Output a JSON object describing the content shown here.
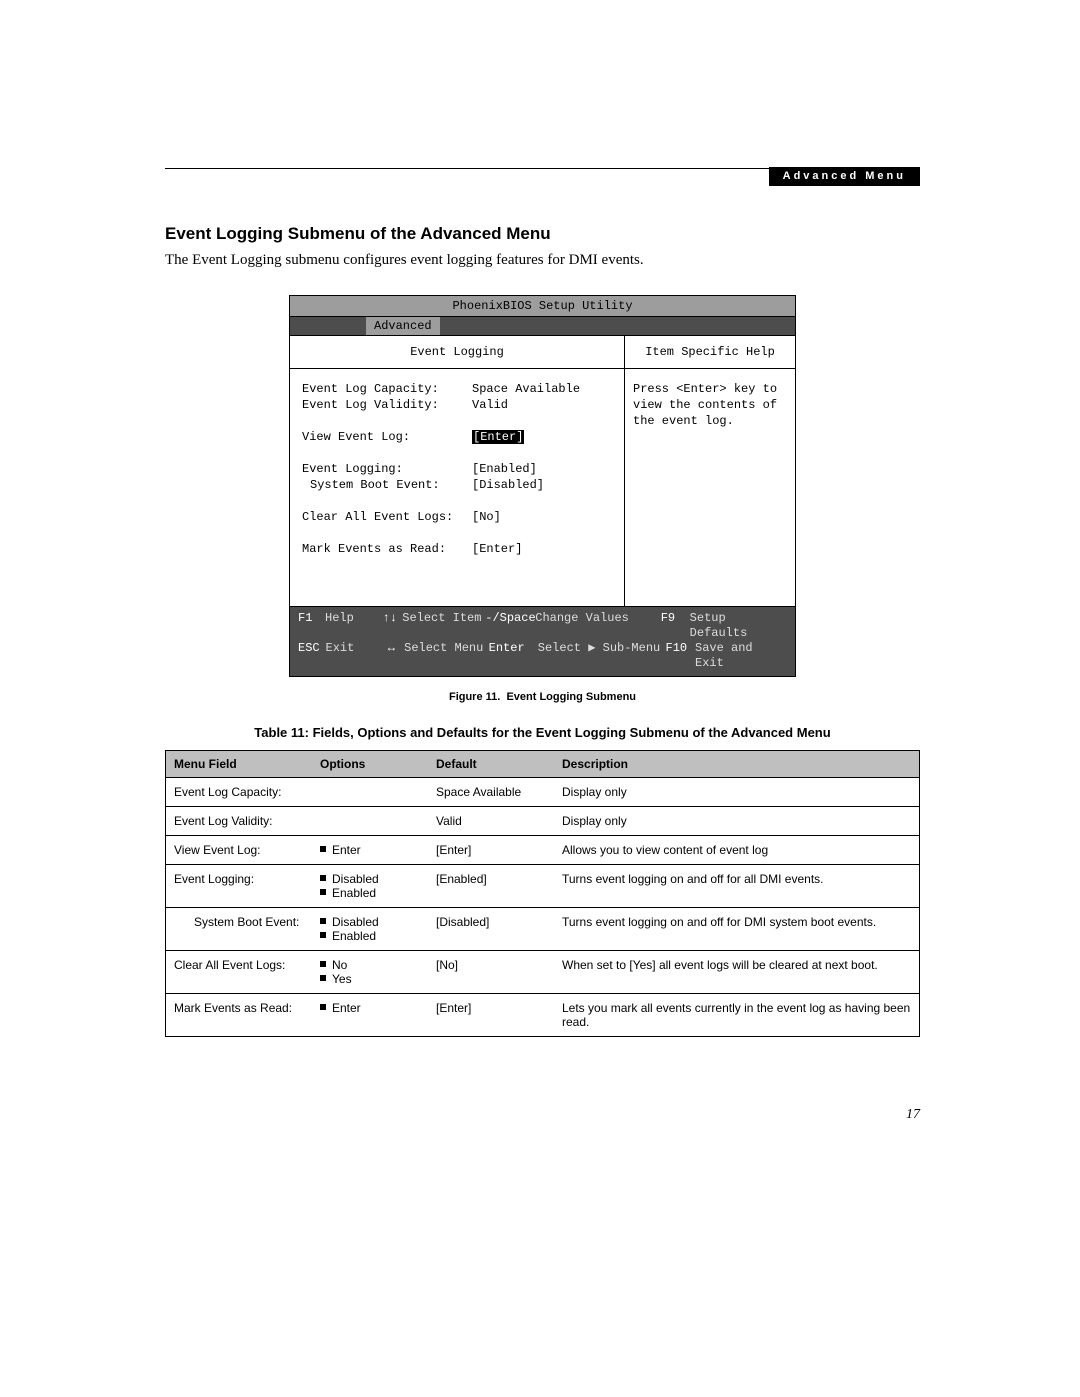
{
  "header_tab": "Advanced Menu",
  "heading": "Event Logging Submenu of the Advanced Menu",
  "intro": "The Event Logging submenu configures event logging features for DMI events.",
  "bios": {
    "title": "PhoenixBIOS Setup Utility",
    "menu_tab": "Advanced",
    "left_header": "Event Logging",
    "right_header": "Item Specific Help",
    "help_text": "Press <Enter> key to view the contents of the event log.",
    "fields": {
      "cap_label": "Event Log Capacity:",
      "cap_val": "Space Available",
      "val_label": "Event Log Validity:",
      "val_val": "Valid",
      "view_label": "View Event Log:",
      "view_val": "[Enter]",
      "log_label": "Event Logging:",
      "log_val": "[Enabled]",
      "boot_label": "System Boot Event:",
      "boot_val": "[Disabled]",
      "clear_label": "Clear All Event Logs:",
      "clear_val": "[No]",
      "mark_label": "Mark Events as Read:",
      "mark_val": "[Enter]"
    },
    "footer": {
      "f1": "F1",
      "help": "Help",
      "arr_ud": "↑↓",
      "sel_item": "Select Item",
      "pm": "-/Space",
      "chg": "Change Values",
      "f9": "F9",
      "setdef": "Setup Defaults",
      "esc": "ESC",
      "exit": "Exit",
      "arr_lr": "↔",
      "sel_menu": "Select Menu",
      "enter": "Enter",
      "sub": "Select ▶ Sub-Menu",
      "f10": "F10",
      "save": "Save and Exit"
    }
  },
  "figcaption_label": "Figure 11.",
  "figcaption_text": "Event Logging Submenu",
  "table_caption": "Table 11: Fields, Options and Defaults for the Event Logging Submenu of the Advanced Menu",
  "table": {
    "headers": {
      "mf": "Menu Field",
      "op": "Options",
      "df": "Default",
      "de": "Description"
    },
    "rows": [
      {
        "mf": "Event Log Capacity:",
        "opts": [],
        "df": "Space Available",
        "de": "Display only",
        "indent": false
      },
      {
        "mf": "Event Log Validity:",
        "opts": [],
        "df": "Valid",
        "de": "Display only",
        "indent": false
      },
      {
        "mf": "View Event Log:",
        "opts": [
          "Enter"
        ],
        "df": "[Enter]",
        "de": "Allows you to view content of event log",
        "indent": false
      },
      {
        "mf": "Event Logging:",
        "opts": [
          "Disabled",
          "Enabled"
        ],
        "df": "[Enabled]",
        "de": "Turns event logging on and off for all DMI events.",
        "indent": false
      },
      {
        "mf": "System Boot Event:",
        "opts": [
          "Disabled",
          "Enabled"
        ],
        "df": "[Disabled]",
        "de": "Turns event logging on and off for DMI system boot events.",
        "indent": true
      },
      {
        "mf": "Clear All Event Logs:",
        "opts": [
          "No",
          "Yes"
        ],
        "df": "[No]",
        "de": "When set to [Yes] all event logs will be cleared at next boot.",
        "indent": false
      },
      {
        "mf": "Mark Events as Read:",
        "opts": [
          "Enter"
        ],
        "df": "[Enter]",
        "de": "Lets you mark all events currently in the event log as having been read.",
        "indent": false
      }
    ]
  },
  "pagenum": "17"
}
